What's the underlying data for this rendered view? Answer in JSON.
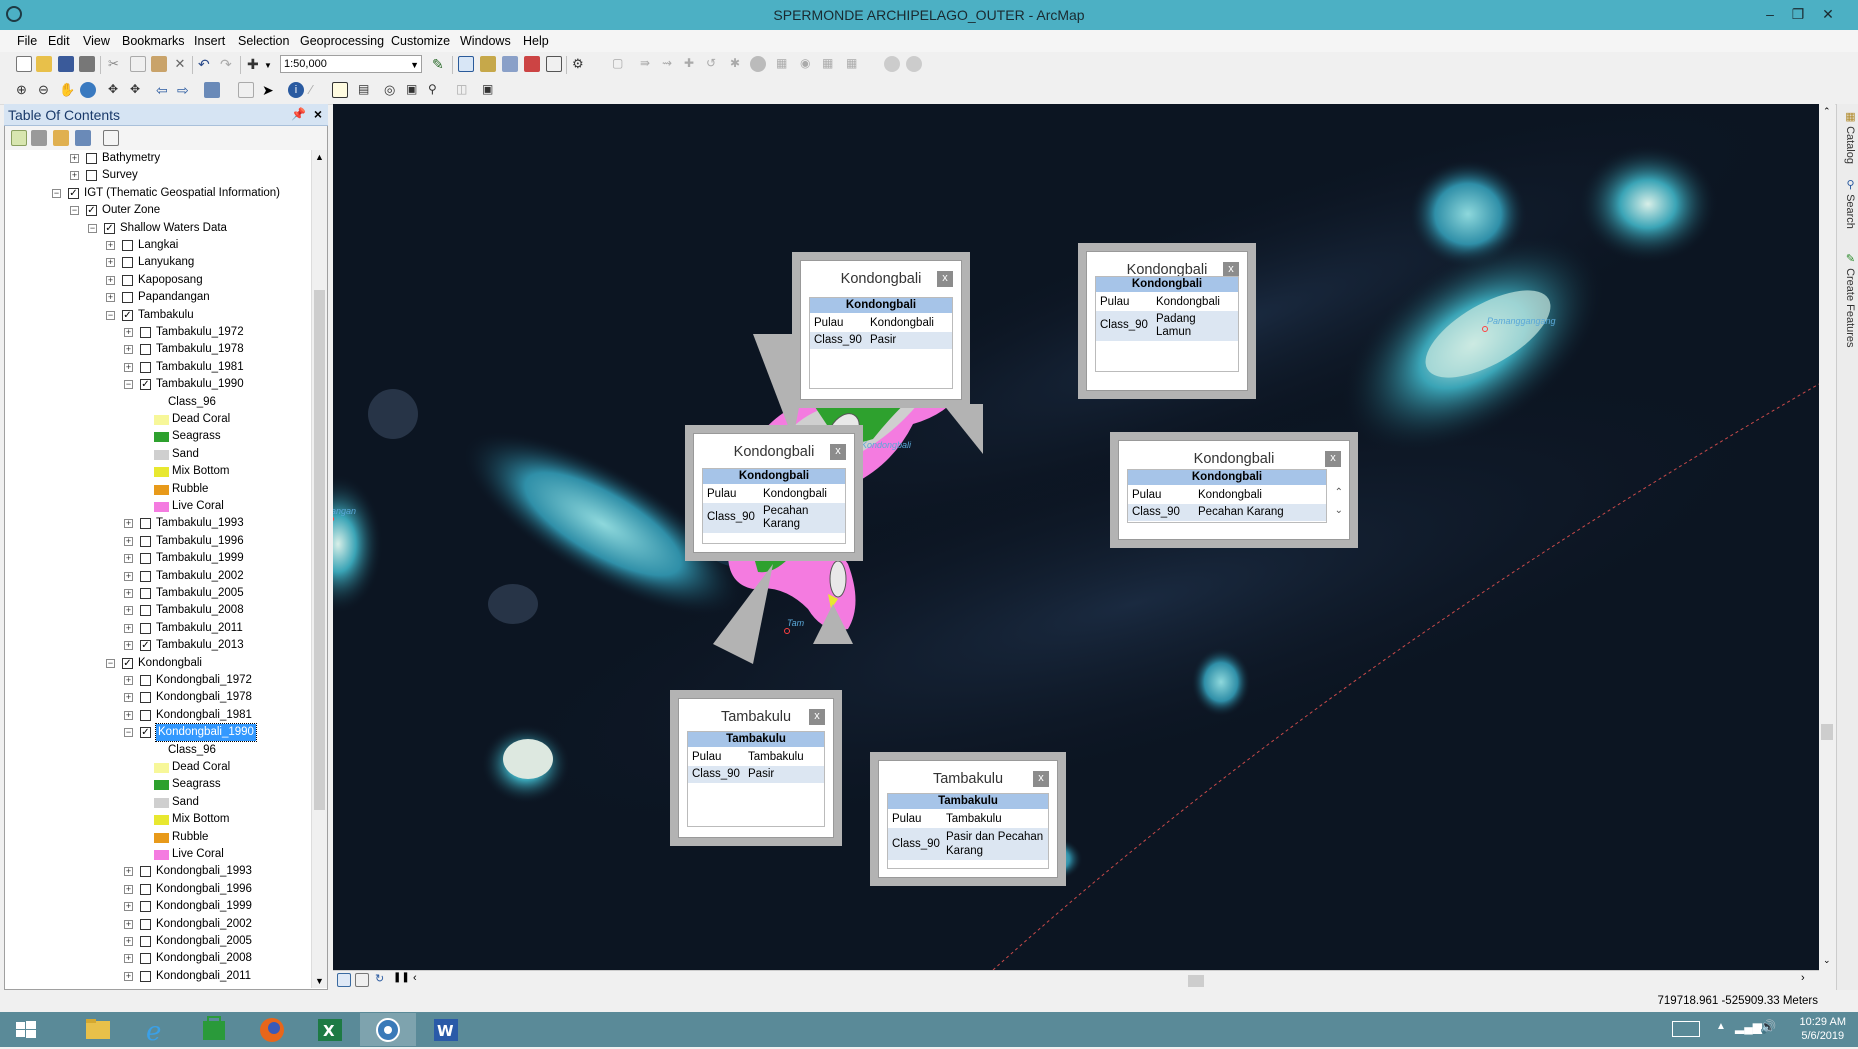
{
  "window": {
    "title": "SPERMONDE ARCHIPELAGO_OUTER - ArcMap"
  },
  "menu": [
    "File",
    "Edit",
    "View",
    "Bookmarks",
    "Insert",
    "Selection",
    "Geoprocessing",
    "Customize",
    "Windows",
    "Help"
  ],
  "toolbar": {
    "scale": "1:50,000"
  },
  "toc": {
    "title": "Table Of Contents",
    "rows": [
      {
        "level": 4,
        "exp": "+",
        "check": false,
        "label": "Bathymetry"
      },
      {
        "level": 4,
        "exp": "+",
        "check": false,
        "label": "Survey"
      },
      {
        "level": 3,
        "exp": "-",
        "check": true,
        "label": "IGT (Thematic Geospatial Information)"
      },
      {
        "level": 4,
        "exp": "-",
        "check": true,
        "label": "Outer Zone"
      },
      {
        "level": 5,
        "exp": "-",
        "check": true,
        "label": "Shallow Waters Data"
      },
      {
        "level": 6,
        "exp": "+",
        "check": false,
        "label": "Langkai"
      },
      {
        "level": 6,
        "exp": "+",
        "check": false,
        "label": "Lanyukang"
      },
      {
        "level": 6,
        "exp": "+",
        "check": false,
        "label": "Kapoposang"
      },
      {
        "level": 6,
        "exp": "+",
        "check": false,
        "label": "Papandangan"
      },
      {
        "level": 6,
        "exp": "-",
        "check": true,
        "label": "Tambakulu"
      },
      {
        "level": 7,
        "exp": "+",
        "check": false,
        "label": "Tambakulu_1972"
      },
      {
        "level": 7,
        "exp": "+",
        "check": false,
        "label": "Tambakulu_1978"
      },
      {
        "level": 7,
        "exp": "+",
        "check": false,
        "label": "Tambakulu_1981"
      },
      {
        "level": 7,
        "exp": "-",
        "check": true,
        "label": "Tambakulu_1990"
      },
      {
        "level": 8,
        "field": true,
        "label": "Class_96"
      },
      {
        "level": 8,
        "swatch": "#f7f799",
        "label": "Dead Coral"
      },
      {
        "level": 8,
        "swatch": "#2ea12e",
        "label": "Seagrass"
      },
      {
        "level": 8,
        "swatch": "#cfcfcf",
        "label": "Sand"
      },
      {
        "level": 8,
        "swatch": "#e8e830",
        "label": "Mix Bottom"
      },
      {
        "level": 8,
        "swatch": "#e89a1a",
        "label": "Rubble"
      },
      {
        "level": 8,
        "swatch": "#f47be0",
        "label": "Live Coral"
      },
      {
        "level": 7,
        "exp": "+",
        "check": false,
        "label": "Tambakulu_1993"
      },
      {
        "level": 7,
        "exp": "+",
        "check": false,
        "label": "Tambakulu_1996"
      },
      {
        "level": 7,
        "exp": "+",
        "check": false,
        "label": "Tambakulu_1999"
      },
      {
        "level": 7,
        "exp": "+",
        "check": false,
        "label": "Tambakulu_2002"
      },
      {
        "level": 7,
        "exp": "+",
        "check": false,
        "label": "Tambakulu_2005"
      },
      {
        "level": 7,
        "exp": "+",
        "check": false,
        "label": "Tambakulu_2008"
      },
      {
        "level": 7,
        "exp": "+",
        "check": false,
        "label": "Tambakulu_2011"
      },
      {
        "level": 7,
        "exp": "+",
        "check": true,
        "label": "Tambakulu_2013"
      },
      {
        "level": 6,
        "exp": "-",
        "check": true,
        "label": "Kondongbali"
      },
      {
        "level": 7,
        "exp": "+",
        "check": false,
        "label": "Kondongbali_1972"
      },
      {
        "level": 7,
        "exp": "+",
        "check": false,
        "label": "Kondongbali_1978"
      },
      {
        "level": 7,
        "exp": "+",
        "check": false,
        "label": "Kondongbali_1981"
      },
      {
        "level": 7,
        "exp": "-",
        "check": true,
        "label": "Kondongbali_1990",
        "selected": true
      },
      {
        "level": 8,
        "field": true,
        "label": "Class_96"
      },
      {
        "level": 8,
        "swatch": "#f7f799",
        "label": "Dead Coral"
      },
      {
        "level": 8,
        "swatch": "#2ea12e",
        "label": "Seagrass"
      },
      {
        "level": 8,
        "swatch": "#cfcfcf",
        "label": "Sand"
      },
      {
        "level": 8,
        "swatch": "#e8e830",
        "label": "Mix Bottom"
      },
      {
        "level": 8,
        "swatch": "#e89a1a",
        "label": "Rubble"
      },
      {
        "level": 8,
        "swatch": "#f47be0",
        "label": "Live Coral"
      },
      {
        "level": 7,
        "exp": "+",
        "check": false,
        "label": "Kondongbali_1993"
      },
      {
        "level": 7,
        "exp": "+",
        "check": false,
        "label": "Kondongbali_1996"
      },
      {
        "level": 7,
        "exp": "+",
        "check": false,
        "label": "Kondongbali_1999"
      },
      {
        "level": 7,
        "exp": "+",
        "check": false,
        "label": "Kondongbali_2002"
      },
      {
        "level": 7,
        "exp": "+",
        "check": false,
        "label": "Kondongbali_2005"
      },
      {
        "level": 7,
        "exp": "+",
        "check": false,
        "label": "Kondongbali_2008"
      },
      {
        "level": 7,
        "exp": "+",
        "check": false,
        "label": "Kondongbali_2011"
      }
    ]
  },
  "popups": [
    {
      "title": "Kondongbali",
      "header": "Kondongbali",
      "rows": [
        {
          "k": "Pulau",
          "v": "Kondongbali"
        },
        {
          "k": "Class_90",
          "v": "Pasir"
        }
      ]
    },
    {
      "title": "Kondongbali",
      "header": "Kondongbali",
      "rows": [
        {
          "k": "Pulau",
          "v": "Kondongbali"
        },
        {
          "k": "Class_90",
          "v": "Padang Lamun"
        }
      ]
    },
    {
      "title": "Kondongbali",
      "header": "Kondongbali",
      "rows": [
        {
          "k": "Pulau",
          "v": "Kondongbali"
        },
        {
          "k": "Class_90",
          "v": "Pecahan Karang"
        }
      ]
    },
    {
      "title": "Kondongbali",
      "header": "Kondongbali",
      "rows": [
        {
          "k": "Pulau",
          "v": "Kondongbali"
        },
        {
          "k": "Class_90",
          "v": "Pecahan Karang"
        }
      ]
    },
    {
      "title": "Tambakulu",
      "header": "Tambakulu",
      "rows": [
        {
          "k": "Pulau",
          "v": "Tambakulu"
        },
        {
          "k": "Class_90",
          "v": "Pasir"
        }
      ]
    },
    {
      "title": "Tambakulu",
      "header": "Tambakulu",
      "rows": [
        {
          "k": "Pulau",
          "v": "Tambakulu"
        },
        {
          "k": "Class_90",
          "v": "Pasir dan Pecahan Karang"
        }
      ]
    }
  ],
  "map_labels": {
    "pamanggangang": "Pamanggangang",
    "kondongbali": "Kondongbali",
    "papandangan": "Papandangan",
    "tambakulu": "Tam"
  },
  "dock_tabs": [
    "Catalog",
    "Search",
    "Create Features"
  ],
  "status": {
    "coordinates": "719718.961  -525909.33 Meters"
  },
  "clock": {
    "time": "10:29 AM",
    "date": "5/6/2019"
  },
  "colors": {
    "dead_coral": "#f7f799",
    "seagrass": "#2ea12e",
    "sand": "#cfcfcf",
    "mix_bottom": "#e8e830",
    "rubble": "#e89a1a",
    "live_coral": "#f47be0",
    "titlebar": "#4cb0c4"
  }
}
